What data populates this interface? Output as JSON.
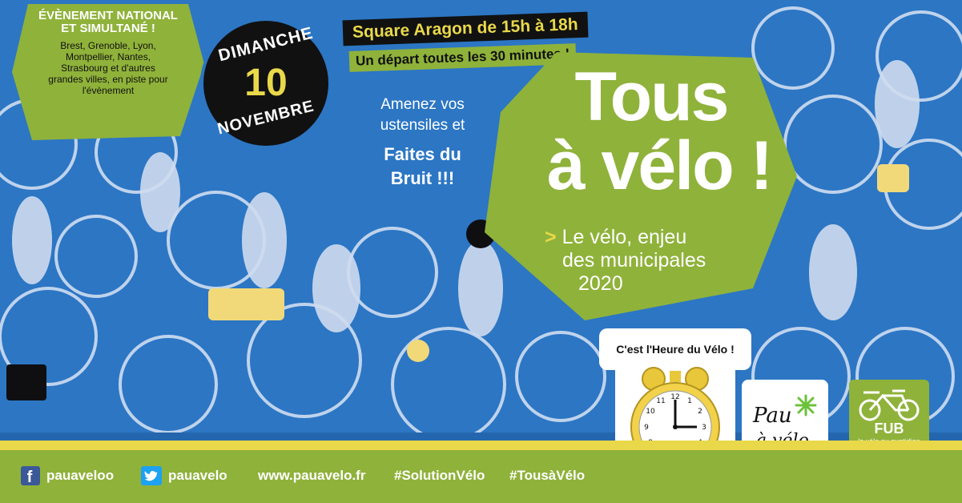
{
  "event_badge": {
    "title_line1": "Évènement national",
    "title_line2": "et simultané !",
    "cities": [
      "Brest, Grenoble, Lyon,",
      "Montpellier, Nantes,",
      "Strasbourg et d'autres",
      "grandes villes, en piste pour",
      "l'évènement"
    ]
  },
  "date_badge": {
    "weekday": "DIMANCHE",
    "day": "10",
    "month": "NOVEMBRE"
  },
  "location_banner": "Square Aragon de 15h à 18h",
  "departure_banner": "Un départ toutes les 30 minutes !",
  "callout": {
    "line1": "Amenez vos",
    "line2": "ustensiles et",
    "line3": "Faites du",
    "line4": "Bruit !!!"
  },
  "headline": {
    "line1": "Tous",
    "line2": "à vélo !"
  },
  "subtitle": {
    "marker": ">",
    "line1": "Le vélo, enjeu",
    "line2": "des municipales",
    "line3": "2020"
  },
  "clock_label": "C'est l'Heure du Vélo !",
  "logos": {
    "pau_line1": "Pau",
    "pau_line2": "à vélo",
    "fub_name": "FUB",
    "fub_tagline": "le vélo au quotidien"
  },
  "footer": {
    "facebook": "pauaveloo",
    "twitter": "pauavelo",
    "website": "www.pauavelo.fr",
    "hashtag1": "#SolutionVélo",
    "hashtag2": "#TousàVélo"
  },
  "colors": {
    "background_blue": "#2c76c4",
    "accent_green": "#8fb23a",
    "accent_yellow": "#e9d84a",
    "badge_black": "#111111"
  },
  "icons": [
    "facebook-icon",
    "twitter-icon",
    "alarm-clock-icon",
    "pau-logo",
    "fub-bike-logo"
  ]
}
